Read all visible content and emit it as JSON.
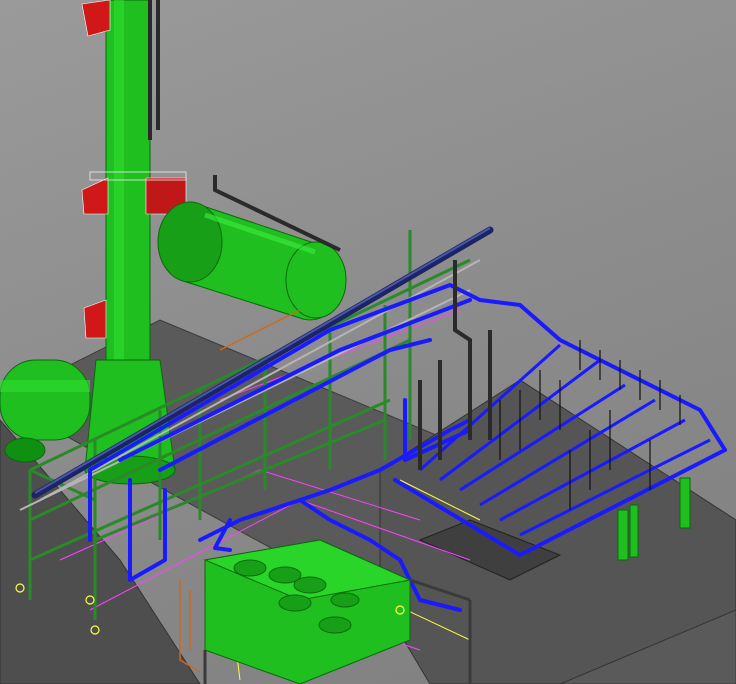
{
  "viewport": {
    "background_color": "#8c8c8c",
    "colors": {
      "equipment_green": "#1fbf1f",
      "equipment_green_dark": "#0a7a0a",
      "pipe_blue": "#1a1aff",
      "pipe_navy": "#1c2466",
      "steel_gray": "#b0b0b0",
      "highlight_red": "#d01818",
      "guide_magenta": "#ff40ff",
      "guide_yellow": "#ffff40",
      "cable_orange": "#c86a20"
    }
  }
}
